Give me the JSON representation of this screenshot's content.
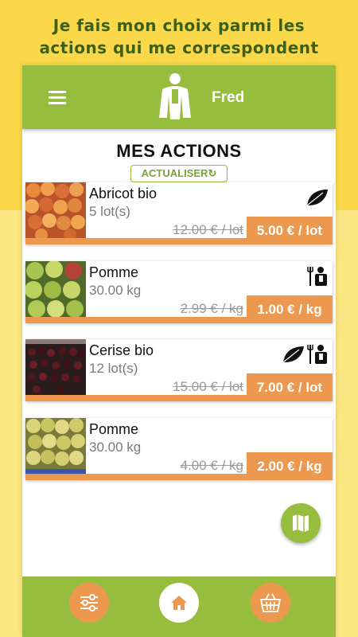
{
  "promo": {
    "line1": "Je fais mon choix parmi les",
    "line2": "actions qui me correspondent"
  },
  "header": {
    "username": "Fred",
    "menu_icon": "hamburger-menu-icon",
    "avatar_icon": "farmer-avatar-icon"
  },
  "main": {
    "title": "MES ACTIONS",
    "refresh_label": "ACTUALISER",
    "refresh_icon": "↻"
  },
  "actions": [
    {
      "name": "Abricot bio",
      "quantity": "5 lot(s)",
      "old_price": "12.00 € / lot",
      "new_price": "5.00 € / lot",
      "image": "apricots",
      "badges": [
        "leaf-icon"
      ]
    },
    {
      "name": "Pomme",
      "quantity": "30.00 kg",
      "old_price": "2.99 € / kg",
      "new_price": "1.00 € / kg",
      "image": "apples-green-red",
      "badges": [
        "farmer-pitchfork-icon"
      ]
    },
    {
      "name": "Cerise bio",
      "quantity": "12 lot(s)",
      "old_price": "15.00 € / lot",
      "new_price": "7.00 € / lot",
      "image": "cherries",
      "badges": [
        "leaf-icon",
        "farmer-pitchfork-icon"
      ]
    },
    {
      "name": "Pomme",
      "quantity": "30.00 kg",
      "old_price": "4.00 € / kg",
      "new_price": "2.00 € / kg",
      "image": "apples-yellow",
      "badges": []
    }
  ],
  "fab": {
    "icon": "map-icon"
  },
  "bottom_nav": {
    "items": [
      "filters-sliders-icon",
      "home-icon",
      "basket-icon"
    ]
  },
  "colors": {
    "green": "#97bd3f",
    "orange": "#ec994f",
    "yellow_top": "#fbd84a",
    "yellow_bottom": "#fce783",
    "promo_text": "#3e5f16"
  }
}
